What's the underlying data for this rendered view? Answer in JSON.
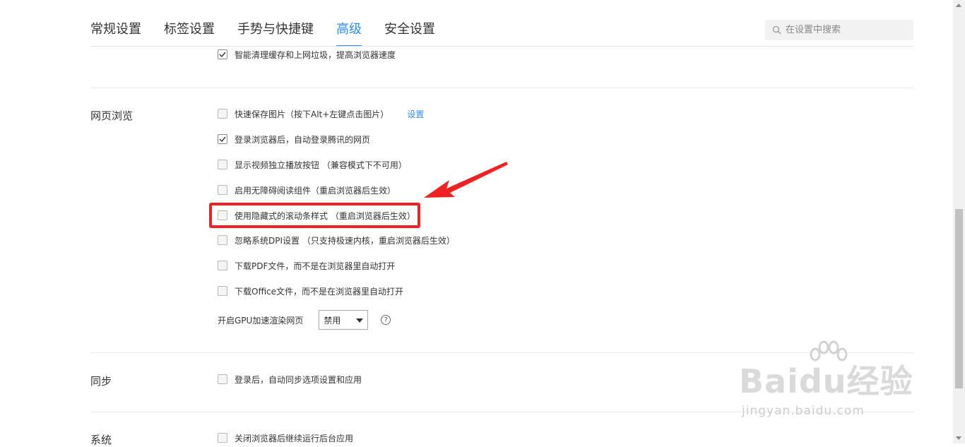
{
  "tabs": [
    {
      "label": "常规设置",
      "active": false
    },
    {
      "label": "标签设置",
      "active": false
    },
    {
      "label": "手势与快捷键",
      "active": false
    },
    {
      "label": "高级",
      "active": true
    },
    {
      "label": "安全设置",
      "active": false
    }
  ],
  "search": {
    "placeholder": "在设置中搜索"
  },
  "top_option": {
    "label": "智能清理缓存和上网垃圾，提高浏览器速度",
    "checked": true
  },
  "sections": {
    "browsing": {
      "title": "网页浏览",
      "options": [
        {
          "label": "快速保存图片（按下Alt+左键点击图片）",
          "checked": false,
          "link": "设置"
        },
        {
          "label": "登录浏览器后，自动登录腾讯的网页",
          "checked": true
        },
        {
          "label": "显示视频独立播放按钮 （兼容模式下不可用）",
          "checked": false
        },
        {
          "label": "启用无障碍阅读组件（重启浏览器后生效）",
          "checked": false
        },
        {
          "label": "使用隐藏式的滚动条样式 （重启浏览器后生效）",
          "checked": false
        },
        {
          "label": "忽略系统DPI设置 （只支持极速内核，重启浏览器后生效）",
          "checked": false
        },
        {
          "label": "下载PDF文件，而不是在浏览器里自动打开",
          "checked": false
        },
        {
          "label": "下载Office文件，而不是在浏览器里自动打开",
          "checked": false
        }
      ],
      "gpu": {
        "label": "开启GPU加速渲染网页",
        "value": "禁用",
        "help": "?"
      }
    },
    "sync": {
      "title": "同步",
      "options": [
        {
          "label": "登录后，自动同步选项设置和应用",
          "checked": false
        }
      ]
    },
    "system": {
      "title": "系统",
      "options": [
        {
          "label": "关闭浏览器后继续运行后台应用",
          "checked": false
        }
      ]
    }
  },
  "annotation": {
    "color": "#ee2222"
  },
  "accent_color": "#2d8cf0",
  "watermark": {
    "main": "Baidu经验",
    "sub": "jingyan.baidu.com"
  }
}
